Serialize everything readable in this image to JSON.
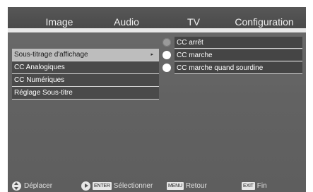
{
  "tabs": [
    "Image",
    "Audio",
    "TV",
    "Configuration"
  ],
  "menu": {
    "items": [
      {
        "label": "Sous-titrage d'affichage",
        "selected": true,
        "has_submenu": true
      },
      {
        "label": "CC Analogiques",
        "selected": false
      },
      {
        "label": "CC Numériques",
        "selected": false
      },
      {
        "label": "Réglage Sous-titre",
        "selected": false
      }
    ],
    "submenu_arrow": "▸"
  },
  "options": [
    {
      "label": "CC arrêt",
      "checked": true
    },
    {
      "label": "CC marche",
      "checked": false
    },
    {
      "label": "CC marche quand sourdine",
      "checked": false
    }
  ],
  "footer": {
    "move": {
      "icon": "up-down-nav-icon",
      "label": "Déplacer"
    },
    "select": {
      "icon": "play-icon",
      "key": "ENTER",
      "label": "Sélectionner"
    },
    "back": {
      "key": "MENU",
      "label": "Retour"
    },
    "exit": {
      "key": "EXIT",
      "label": "Fin"
    }
  },
  "colors": {
    "background": "#626262",
    "selected_item": "#bdbdbd",
    "item": "#4a4a4a",
    "divider": "#d6d6d6"
  }
}
